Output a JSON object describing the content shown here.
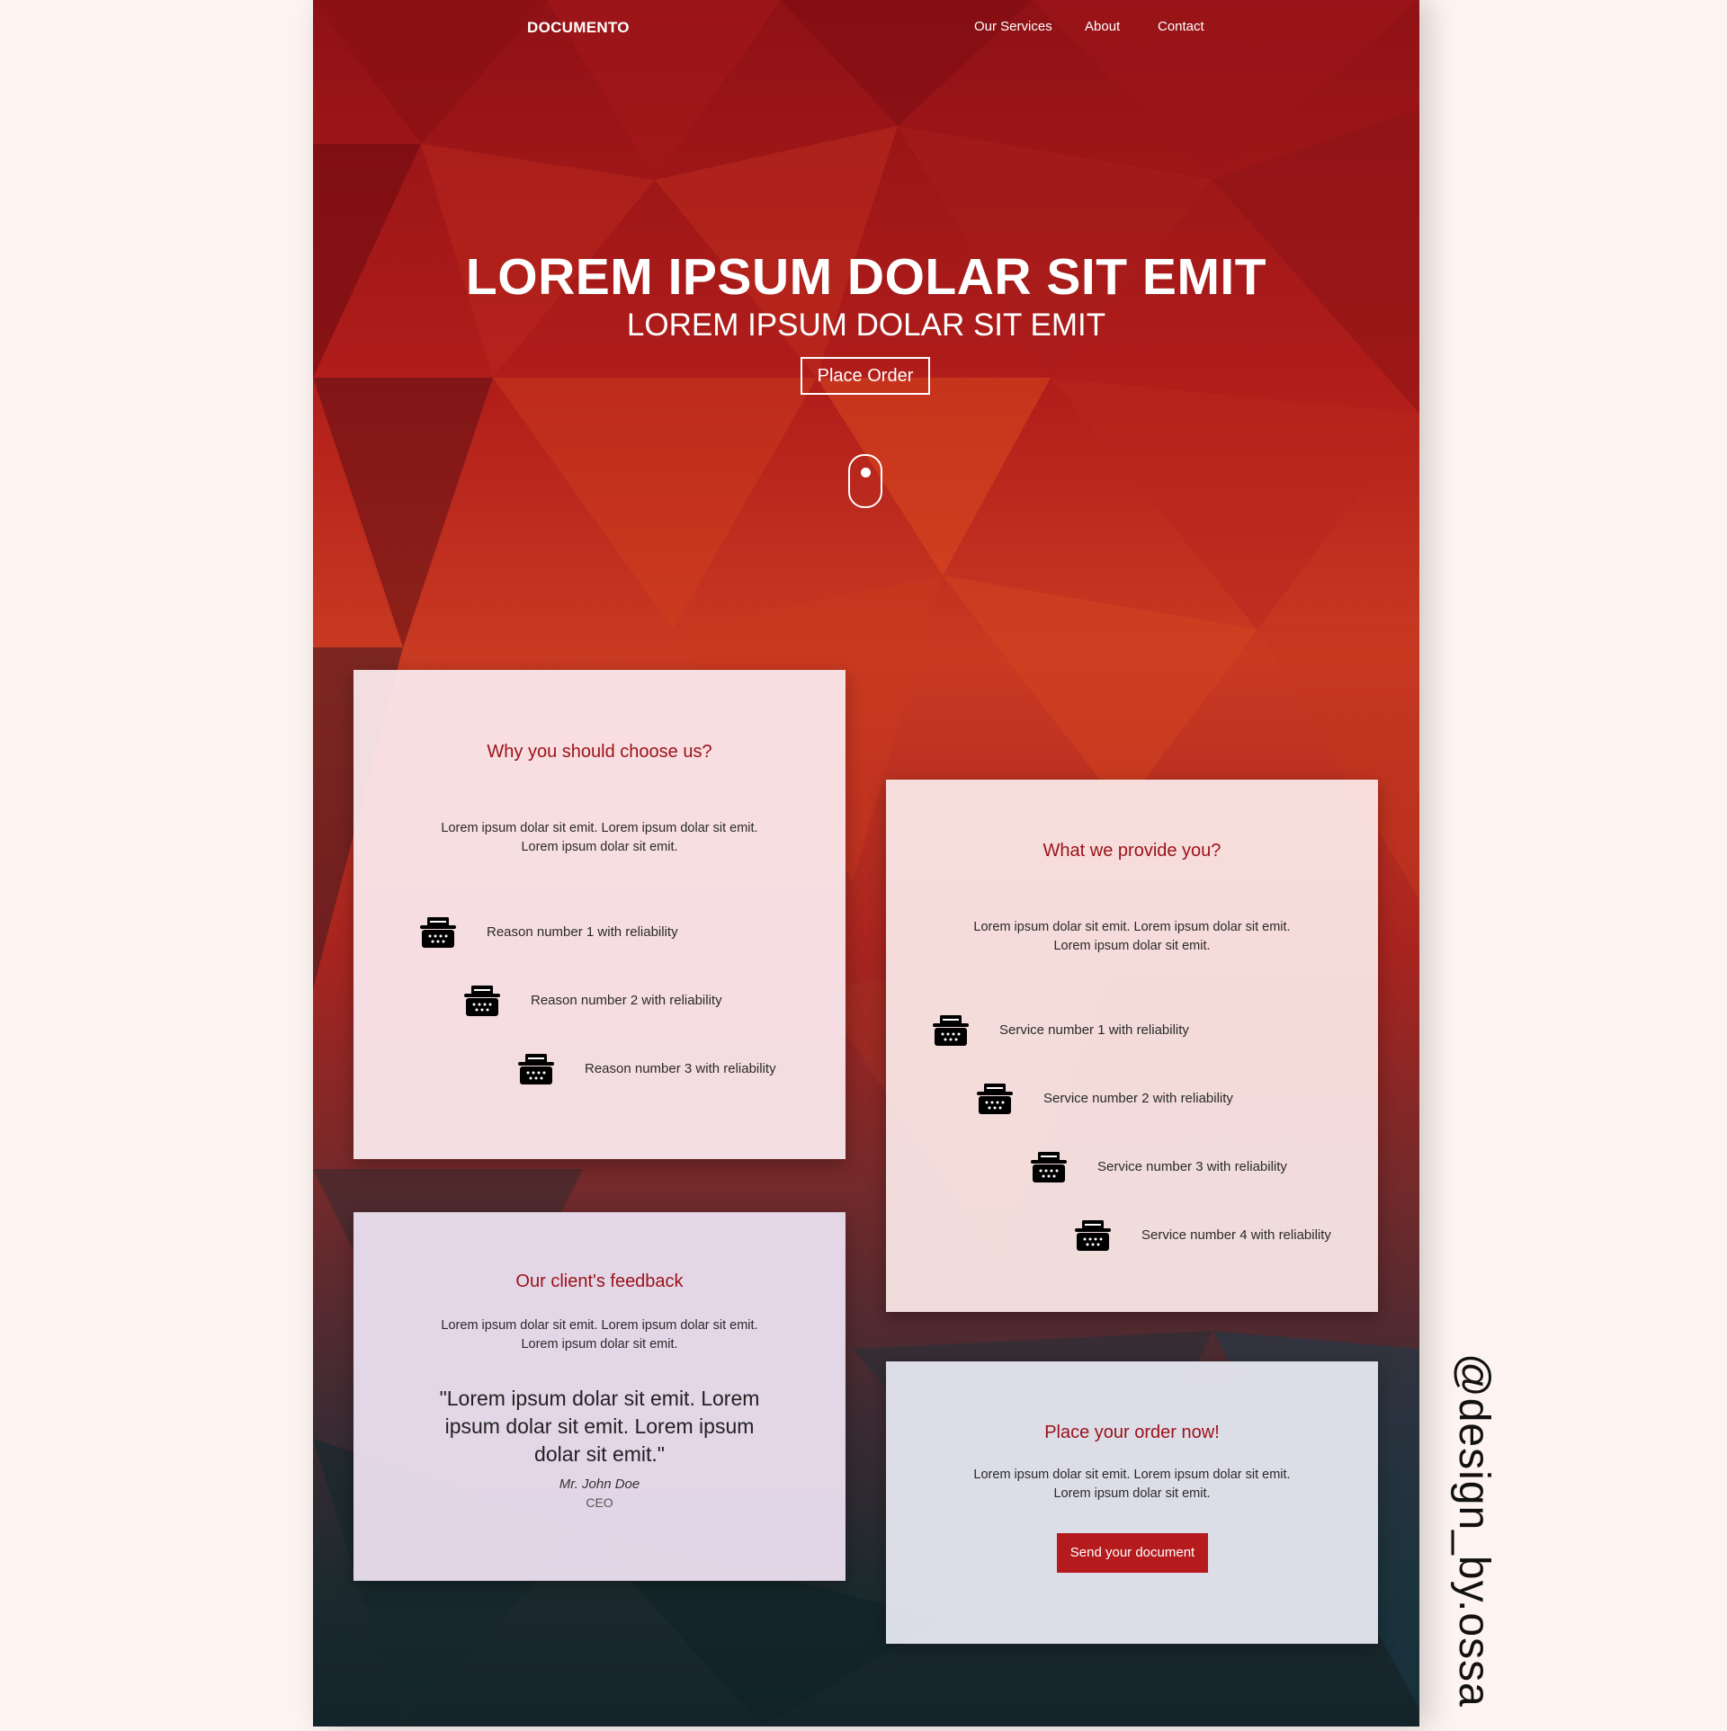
{
  "nav": {
    "logo": "DOCUMENTO",
    "links": [
      "Our Services",
      "About",
      "Contact"
    ]
  },
  "hero": {
    "title": "LOREM IPSUM DOLAR SIT EMIT",
    "subtitle": "LOREM IPSUM DOLAR SIT EMIT",
    "button": "Place Order"
  },
  "why": {
    "title": "Why you should choose us?",
    "desc": "Lorem ipsum dolar sit emit. Lorem ipsum dolar sit emit. Lorem ipsum dolar sit emit.",
    "items": [
      "Reason number 1 with reliability",
      "Reason number 2 with reliability",
      "Reason number 3 with reliability"
    ]
  },
  "provide": {
    "title": "What we provide you?",
    "desc": "Lorem ipsum dolar sit emit. Lorem ipsum dolar sit emit. Lorem ipsum dolar sit emit.",
    "items": [
      "Service number 1 with reliability",
      "Service number 2 with reliability",
      "Service number 3 with reliability",
      "Service number 4 with reliability"
    ]
  },
  "feedback": {
    "title": "Our client's feedback",
    "desc": "Lorem ipsum dolar sit emit. Lorem ipsum dolar sit emit. Lorem ipsum dolar sit emit.",
    "quote": "\"Lorem ipsum dolar sit emit. Lorem ipsum dolar sit emit. Lorem ipsum dolar sit emit.\"",
    "author": "Mr. John Doe",
    "role": "CEO"
  },
  "order": {
    "title": "Place your order now!",
    "desc": "Lorem ipsum dolar sit emit. Lorem ipsum dolar sit emit. Lorem ipsum dolar sit emit.",
    "button": "Send your document"
  },
  "watermark": "@design_by.ossa",
  "icons": {
    "item_icon": "typewriter-icon",
    "scroll_icon": "mouse-scroll-icon"
  },
  "colors": {
    "accent": "#9b1118",
    "button": "#b51b1d",
    "background": "#fdf4f1"
  }
}
